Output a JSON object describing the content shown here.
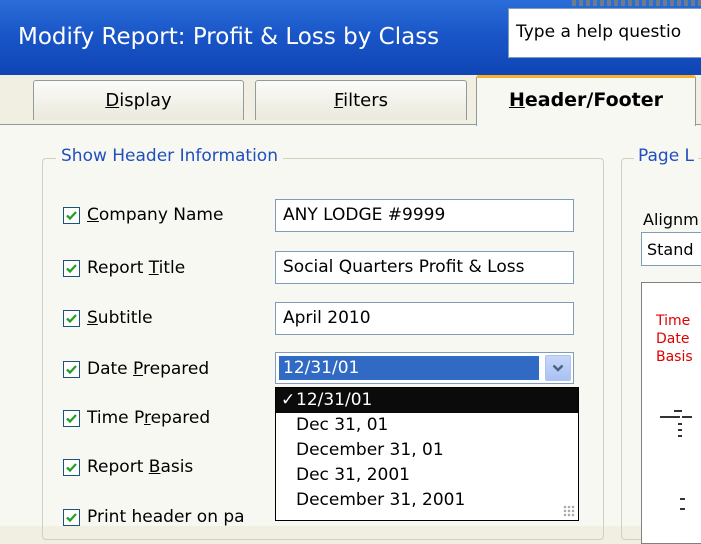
{
  "window": {
    "title": "Modify Report: Profit & Loss by Class"
  },
  "help_search": {
    "placeholder": "Type a help questio"
  },
  "tabs": [
    {
      "pre": "",
      "key": "D",
      "post": "isplay",
      "active": false
    },
    {
      "pre": "",
      "key": "F",
      "post": "ilters",
      "active": false
    },
    {
      "pre": "",
      "key": "H",
      "post": "eader/Footer",
      "active": true
    }
  ],
  "header_info": {
    "group_label": "Show Header Information",
    "company_name": {
      "pre": "",
      "key": "C",
      "post": "ompany Name",
      "checked": true,
      "value": "ANY LODGE #9999"
    },
    "report_title": {
      "pre": "Report ",
      "key": "T",
      "post": "itle",
      "checked": true,
      "value": "Social Quarters Profit & Loss"
    },
    "subtitle": {
      "pre": "",
      "key": "S",
      "post": "ubtitle",
      "checked": true,
      "value": "April 2010"
    },
    "date_prepared": {
      "pre": "Date ",
      "key": "P",
      "post": "repared",
      "checked": true,
      "value": "12/31/01"
    },
    "time_prepared": {
      "pre": "Time P",
      "key": "r",
      "post": "epared",
      "checked": true
    },
    "report_basis": {
      "pre": "Report ",
      "key": "B",
      "post": "asis",
      "checked": true
    },
    "print_header": {
      "text": "Print header on pa",
      "checked": true
    }
  },
  "date_format_options": [
    {
      "label": "12/31/01",
      "selected": true,
      "check": "✓"
    },
    {
      "label": "Dec 31, 01",
      "selected": false
    },
    {
      "label": "December 31, 01",
      "selected": false
    },
    {
      "label": "Dec 31, 2001",
      "selected": false
    },
    {
      "label": "December 31, 2001",
      "selected": false
    }
  ],
  "page_layout": {
    "group_label": "Page L",
    "alignment_label": "Alignm",
    "alignment_value": "Stand",
    "preview_lines": [
      "Time",
      "Date",
      "Basis"
    ]
  },
  "colors": {
    "accent": "#316ac5",
    "titlebar": "#1a56c8",
    "group_label": "#1f4fbd",
    "preview_red": "#e00000"
  }
}
